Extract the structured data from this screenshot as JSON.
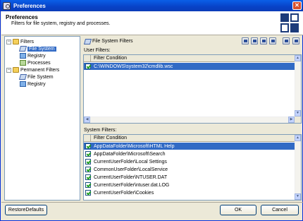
{
  "window": {
    "title": "Preferences"
  },
  "header": {
    "title": "Preferences",
    "subtitle": "Filters for file system, registry and processes."
  },
  "tree": {
    "items": [
      {
        "label": "Filters",
        "level": 0,
        "icon": "folder-icon",
        "expander": "−"
      },
      {
        "label": "File System",
        "level": 1,
        "icon": "file-system-icon",
        "selected": true
      },
      {
        "label": "Registry",
        "level": 1,
        "icon": "registry-icon"
      },
      {
        "label": "Processes",
        "level": 1,
        "icon": "process-icon"
      },
      {
        "label": "Permanent Filters",
        "level": 0,
        "icon": "folder-icon",
        "expander": "−"
      },
      {
        "label": "File System",
        "level": 1,
        "icon": "file-system-icon"
      },
      {
        "label": "Registry",
        "level": 1,
        "icon": "registry-icon"
      }
    ]
  },
  "panel": {
    "title": "File System Filters"
  },
  "user_filters": {
    "label": "User Filters:",
    "column": "Filter Condition",
    "rows": [
      "C:\\WINDOWS\\system32\\cmdlib.wsc"
    ]
  },
  "system_filters": {
    "label": "System Filters:",
    "column": "Filter Condition",
    "rows": [
      "AppDataFolder\\Microsoft\\HTML Help",
      "AppDataFolder\\Microsoft\\Search",
      "CurrentUserFolder\\Local Settings",
      "CommonUserFolder\\LocalService",
      "CurrentUserFolder\\NTUSER.DAT",
      "CurrentUserFolder\\ntuser.dat.LOG",
      "CurrentUserFolder\\Cookies"
    ]
  },
  "buttons": {
    "restore": "RestoreDefaults",
    "ok": "OK",
    "cancel": "Cancel"
  },
  "colors": {
    "selection": "#316ac5",
    "titlebar": "#0842c6"
  }
}
